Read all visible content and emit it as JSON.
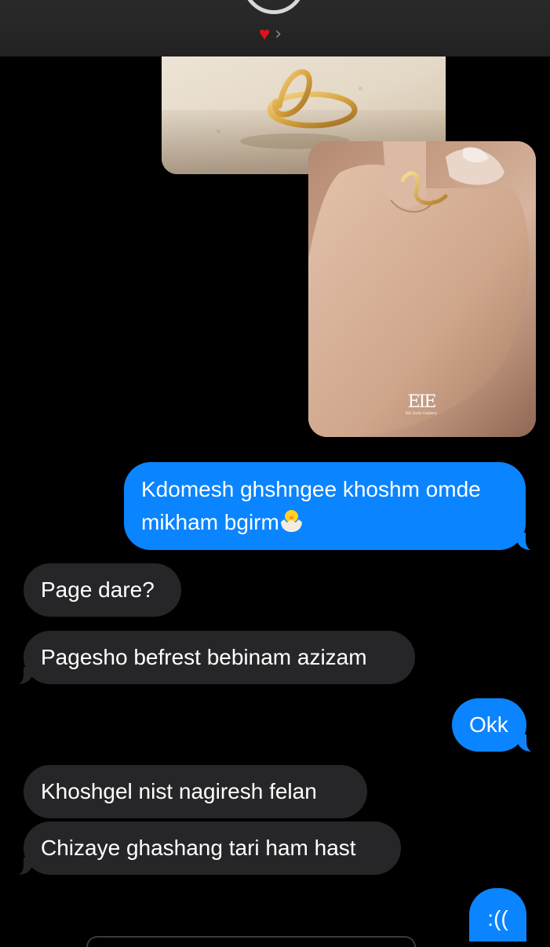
{
  "header": {
    "contact_icon": "heart-icon",
    "heart_glyph": "♥",
    "chevron_glyph": "›",
    "heart_color": "#e0121b"
  },
  "photos": {
    "hand_photo_logo": {
      "monogram": "EIE",
      "caption": "Eli Gold Gallery"
    }
  },
  "messages": [
    {
      "direction": "outgoing",
      "text": "Kdomesh ghshngee khoshm omde mikham bgirm",
      "emoji": "hatching-chick-icon"
    },
    {
      "direction": "incoming",
      "text": "Page dare?"
    },
    {
      "direction": "incoming",
      "text": "Pagesho befrest bebinam azizam"
    },
    {
      "direction": "outgoing",
      "text": "Okk"
    },
    {
      "direction": "incoming",
      "text": "Khoshgel nist nagiresh felan"
    },
    {
      "direction": "incoming",
      "text": "Chizaye ghashang tari ham hast"
    },
    {
      "direction": "outgoing",
      "text": ":(("
    }
  ],
  "colors": {
    "outgoing_bubble": "#0a84ff",
    "incoming_bubble": "#262628",
    "background": "#000000"
  }
}
